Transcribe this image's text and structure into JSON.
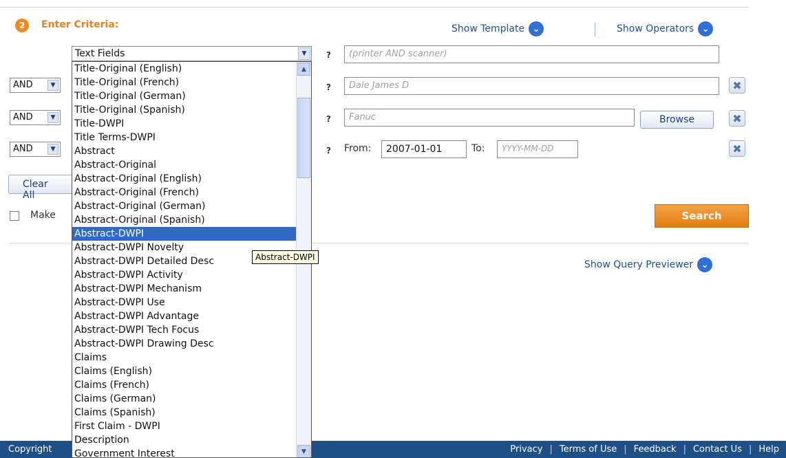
{
  "header": {
    "step_number": "2",
    "step_title": "Enter Criteria:",
    "show_template": "Show Template",
    "show_operators": "Show Operators"
  },
  "rows": [
    {
      "field_select": "Text Fields",
      "help": "?",
      "placeholder": "(printer AND scanner)"
    },
    {
      "operator": "AND",
      "help": "?",
      "placeholder": "Dale James D"
    },
    {
      "operator": "AND",
      "help": "?",
      "placeholder": "Fanuc",
      "browse_label": "Browse"
    },
    {
      "operator": "AND",
      "help": "?",
      "from_label": "From:",
      "from_value": "2007-01-01",
      "to_label": "To:",
      "to_placeholder": "YYYY-MM-DD"
    }
  ],
  "buttons": {
    "clear_all": "Clear All",
    "search": "Search",
    "make_label": "Make"
  },
  "show_query_previewer": "Show Query Previewer",
  "dropdown": {
    "selected": "Abstract-DWPI",
    "tooltip": "Abstract-DWPI",
    "options": [
      "Title-Original (English)",
      "Title-Original (French)",
      "Title-Original (German)",
      "Title-Original (Spanish)",
      "Title-DWPI",
      "Title Terms-DWPI",
      "Abstract",
      "Abstract-Original",
      "Abstract-Original (English)",
      "Abstract-Original (French)",
      "Abstract-Original (German)",
      "Abstract-Original (Spanish)",
      "Abstract-DWPI",
      "Abstract-DWPI Novelty",
      "Abstract-DWPI Detailed Desc",
      "Abstract-DWPI Activity",
      "Abstract-DWPI Mechanism",
      "Abstract-DWPI Use",
      "Abstract-DWPI Advantage",
      "Abstract-DWPI Tech Focus",
      "Abstract-DWPI Drawing Desc",
      "Claims",
      "Claims (English)",
      "Claims (French)",
      "Claims (German)",
      "Claims (Spanish)",
      "First Claim - DWPI",
      "Description",
      "Government Interest"
    ]
  },
  "footer": {
    "copyright": "Copyright",
    "links": [
      "Privacy",
      "Terms of Use",
      "Feedback",
      "Contact Us",
      "Help"
    ]
  },
  "colors": {
    "accent_orange": "#e8821c",
    "footer_blue": "#1e4f86",
    "selection_blue": "#316ac5"
  }
}
